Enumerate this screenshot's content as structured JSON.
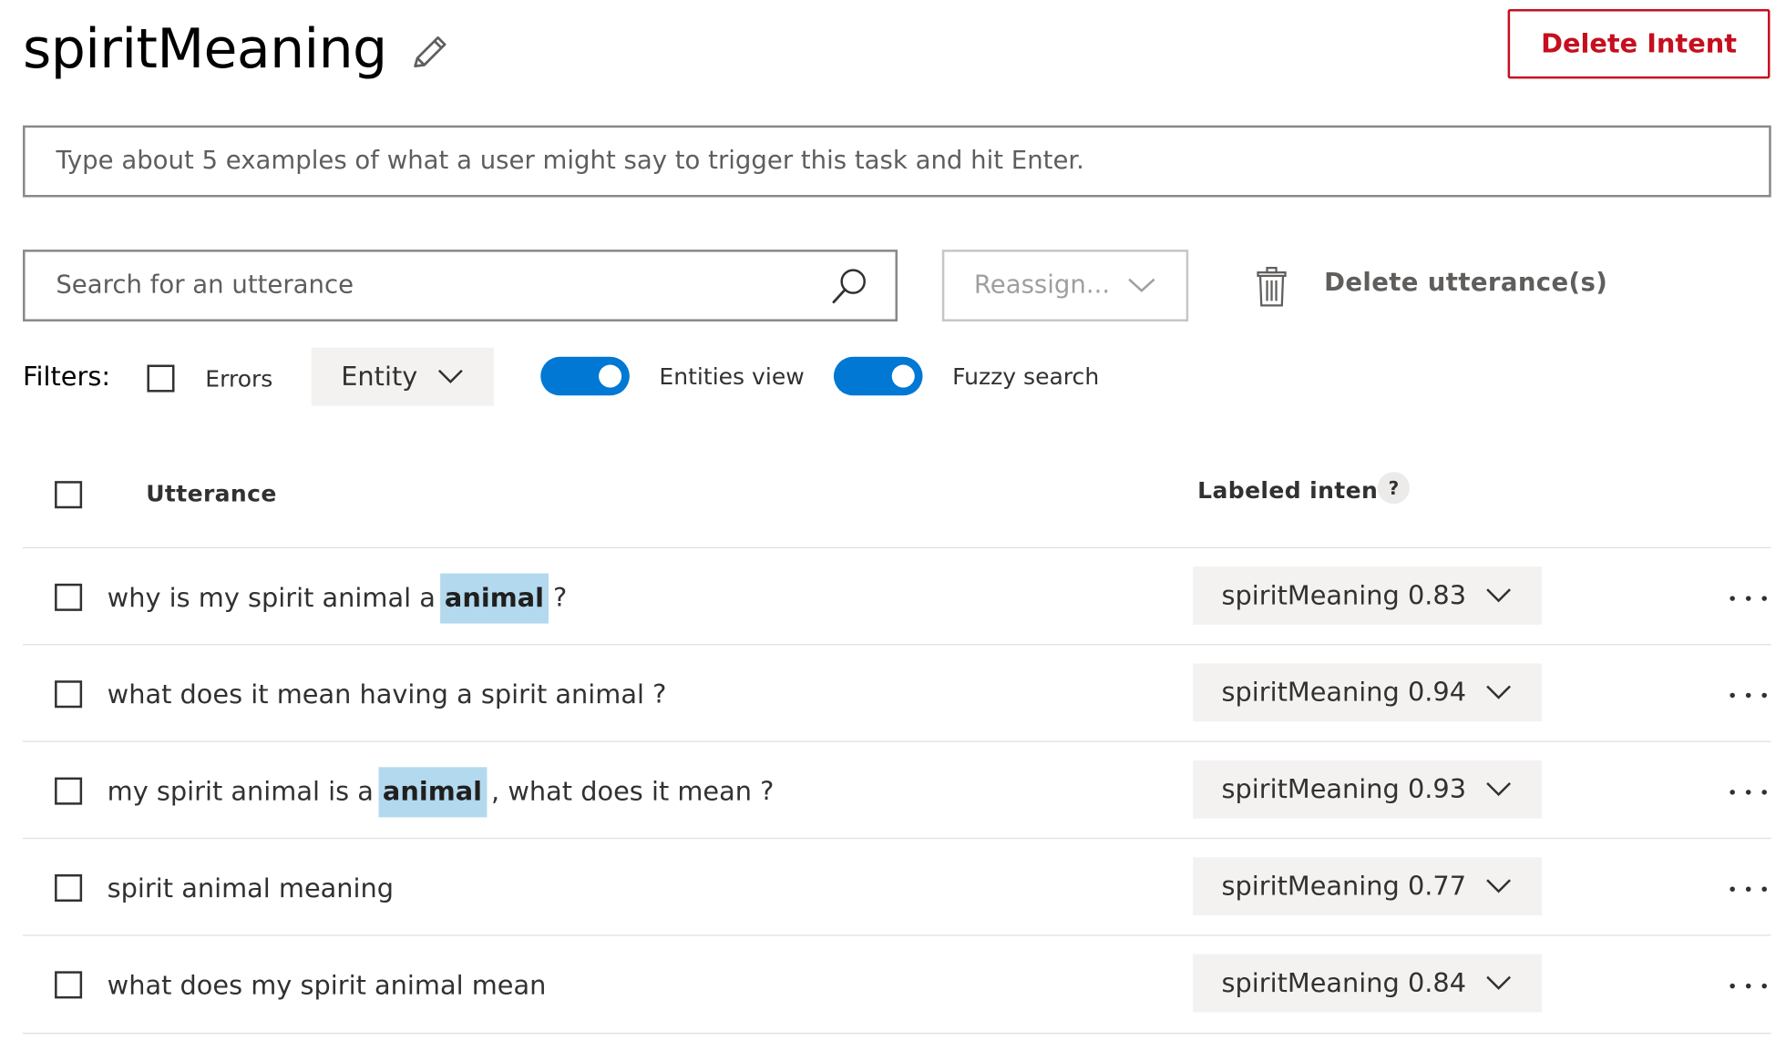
{
  "header": {
    "title": "spiritMeaning",
    "delete_intent_label": "Delete Intent"
  },
  "example_input": {
    "placeholder": "Type about 5 examples of what a user might say to trigger this task and hit Enter."
  },
  "toolbar": {
    "search_placeholder": "Search for an utterance",
    "reassign_label": "Reassign...",
    "delete_utterances_label": "Delete utterance(s)"
  },
  "filters": {
    "label": "Filters:",
    "errors_label": "Errors",
    "errors_checked": false,
    "entity_label": "Entity",
    "entities_view_label": "Entities view",
    "entities_view_on": true,
    "fuzzy_search_label": "Fuzzy search",
    "fuzzy_search_on": true
  },
  "table": {
    "col_utterance": "Utterance",
    "col_labeled_intent": "Labeled intent",
    "help_glyph": "?",
    "rows": [
      {
        "segments": [
          {
            "text": "why is my spirit animal a"
          },
          {
            "text": "animal",
            "entity": true
          },
          {
            "text": "?"
          }
        ],
        "intent": "spiritMeaning 0.83"
      },
      {
        "segments": [
          {
            "text": "what does it mean having a spirit animal ?"
          }
        ],
        "intent": "spiritMeaning 0.94"
      },
      {
        "segments": [
          {
            "text": "my spirit animal is a"
          },
          {
            "text": "animal",
            "entity": true
          },
          {
            "text": ", what does it mean ?"
          }
        ],
        "intent": "spiritMeaning 0.93"
      },
      {
        "segments": [
          {
            "text": "spirit animal meaning"
          }
        ],
        "intent": "spiritMeaning 0.77"
      },
      {
        "segments": [
          {
            "text": "what does my spirit animal mean"
          }
        ],
        "intent": "spiritMeaning 0.84"
      }
    ]
  },
  "colors": {
    "accent": "#0078d4",
    "danger": "#c50f1f",
    "entity_highlight": "#b3d9ef"
  },
  "icons": [
    "pencil-icon",
    "search-icon",
    "chevron-down-icon",
    "trash-icon",
    "help-icon",
    "more-icon"
  ]
}
